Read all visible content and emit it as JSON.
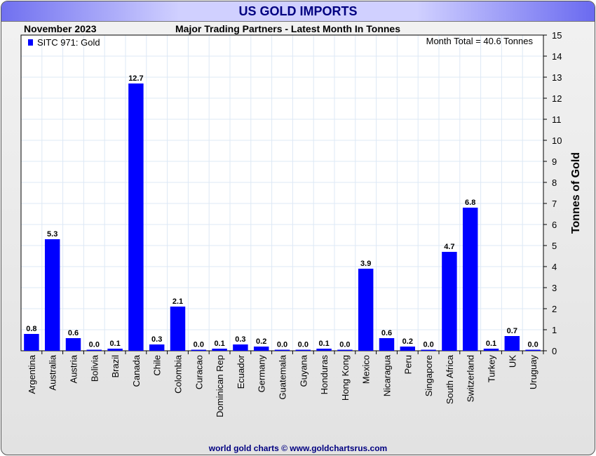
{
  "header": {
    "title": "US GOLD IMPORTS",
    "period": "November 2023",
    "subtitle": "Major Trading Partners - Latest Month In Tonnes"
  },
  "footer": "world gold charts © www.goldchartsrus.com",
  "colors": {
    "bar": "#0000ff",
    "title": "#000080"
  },
  "chart_data": {
    "type": "bar",
    "title": "US GOLD IMPORTS",
    "subtitle": "Major Trading Partners - Latest Month In Tonnes",
    "annotation": "Month Total = 40.6 Tonnes",
    "legend": {
      "entries": [
        "SITC 971: Gold"
      ],
      "placement": "top-left"
    },
    "ylabel": "Tonnes of Gold",
    "xlabel": "",
    "ylim": [
      0,
      15
    ],
    "yticks": [
      0,
      1,
      2,
      3,
      4,
      5,
      6,
      7,
      8,
      9,
      10,
      11,
      12,
      13,
      14,
      15
    ],
    "grid": true,
    "categories": [
      "Argentina",
      "Australia",
      "Austria",
      "Bolivia",
      "Brazil",
      "Canada",
      "Chile",
      "Colombia",
      "Curacao",
      "Dominican Rep",
      "Ecuador",
      "Germany",
      "Guatemala",
      "Guyana",
      "Honduras",
      "Hong Kong",
      "Mexico",
      "Nicaragua",
      "Peru",
      "Singapore",
      "South Africa",
      "Switzerland",
      "Turkey",
      "UK",
      "Uruguay"
    ],
    "values": [
      0.8,
      5.3,
      0.6,
      0.0,
      0.1,
      12.7,
      0.3,
      2.1,
      0.0,
      0.1,
      0.3,
      0.2,
      0.0,
      0.0,
      0.1,
      0.0,
      3.9,
      0.6,
      0.2,
      0.0,
      4.7,
      6.8,
      0.1,
      0.7,
      0.0
    ]
  }
}
